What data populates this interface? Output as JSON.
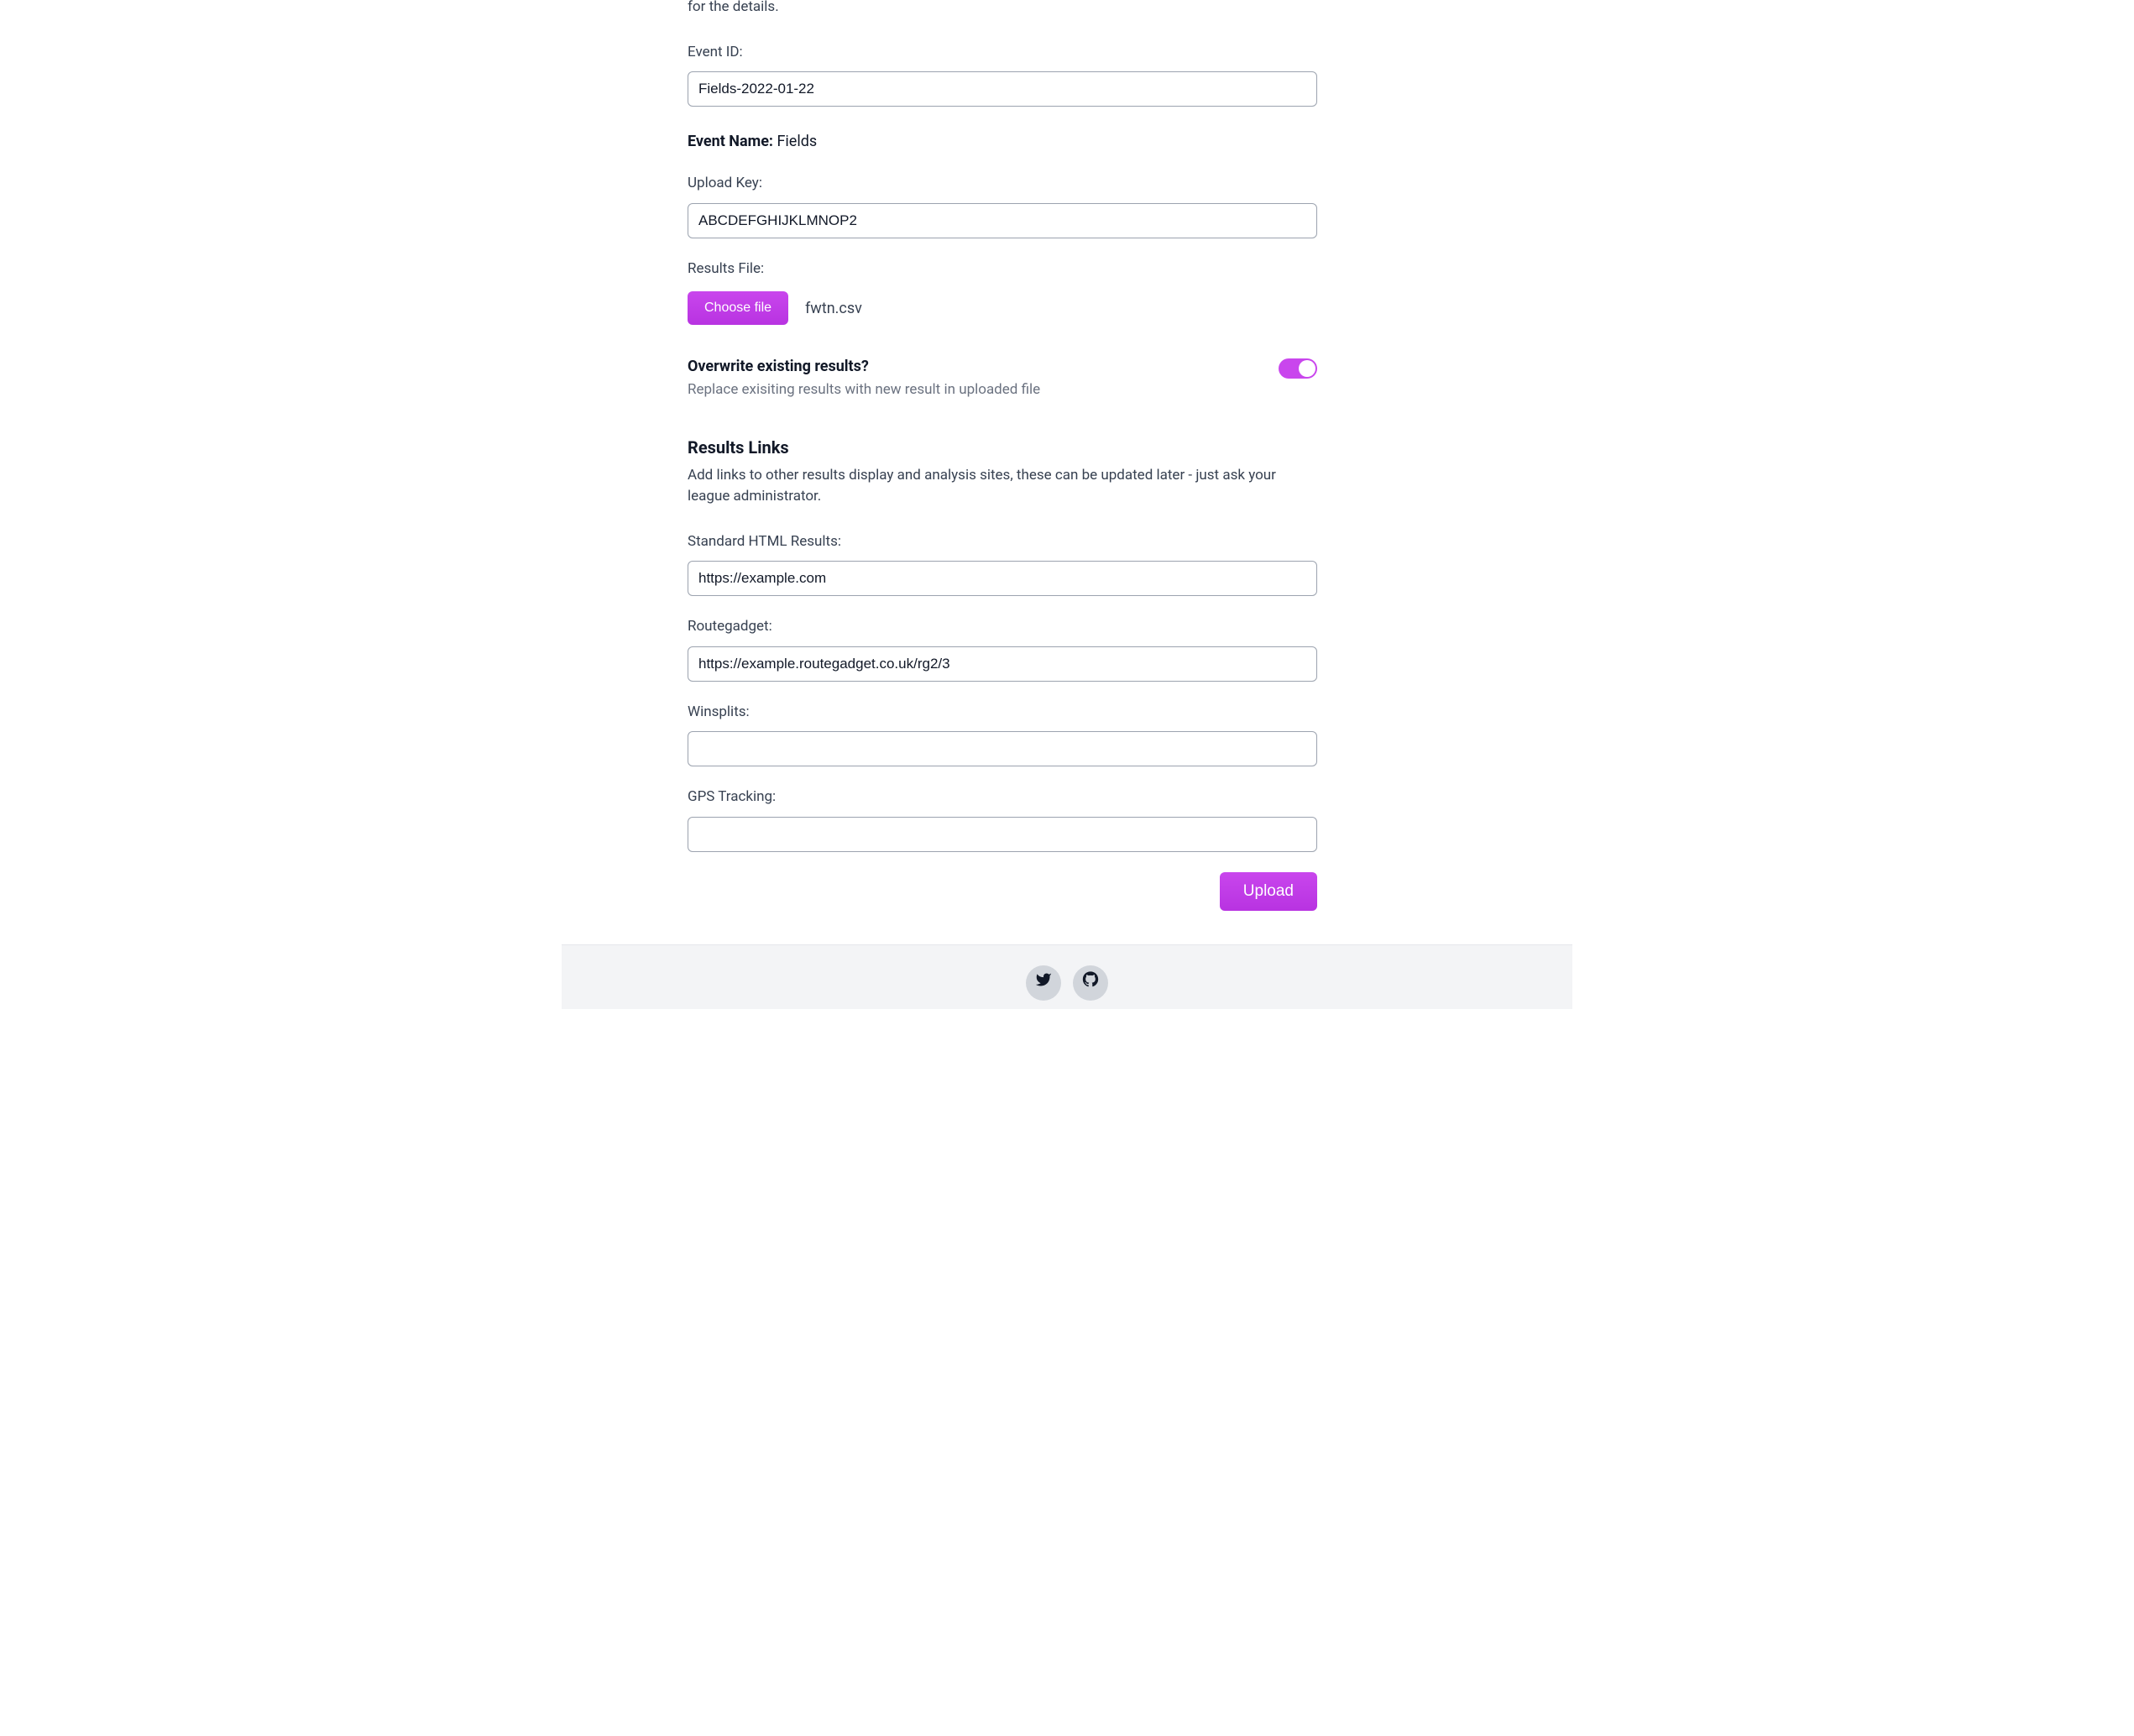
{
  "intro_fragment": "for the details.",
  "eventId": {
    "label": "Event ID:",
    "value": "Fields-2022-01-22"
  },
  "eventName": {
    "label": "Event Name:",
    "value": "Fields"
  },
  "uploadKey": {
    "label": "Upload Key:",
    "value": "ABCDEFGHIJKLMNOP2"
  },
  "resultsFile": {
    "label": "Results File:",
    "chooseLabel": "Choose file",
    "fileName": "fwtn.csv"
  },
  "overwrite": {
    "title": "Overwrite existing results?",
    "desc": "Replace exisiting results with new result in uploaded file",
    "on": true
  },
  "resultsLinks": {
    "title": "Results Links",
    "desc": "Add links to other results display and analysis sites, these can be updated later - just ask your league administrator.",
    "standard": {
      "label": "Standard HTML Results:",
      "value": "https://example.com"
    },
    "routegadget": {
      "label": "Routegadget:",
      "value": "https://example.routegadget.co.uk/rg2/3"
    },
    "winsplits": {
      "label": "Winsplits:",
      "value": ""
    },
    "gps": {
      "label": "GPS Tracking:",
      "value": ""
    }
  },
  "actions": {
    "upload": "Upload"
  },
  "footer": {
    "twitter": "twitter-icon",
    "github": "github-icon"
  }
}
